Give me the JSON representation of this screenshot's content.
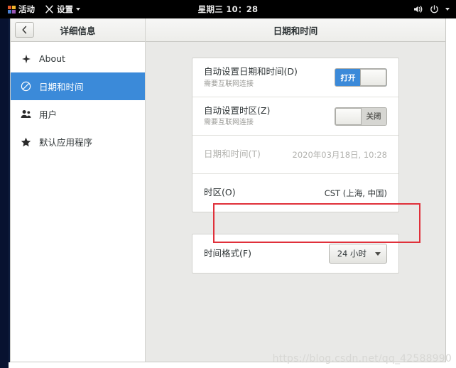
{
  "topbar": {
    "activities_label": "活动",
    "activities_icon": "activities-grid-icon",
    "app_menu_label": "设置",
    "app_menu_icon": "tools-icon",
    "app_menu_caret": "chevron-down-icon",
    "clock": "星期三 10：28",
    "volume_icon": "volume-speaker-icon",
    "power_icon": "power-icon",
    "system_caret": "chevron-down-icon"
  },
  "sidebar": {
    "back_icon": "chevron-left-icon",
    "title": "详细信息",
    "items": [
      {
        "label": "About",
        "icon": "sparkle-icon",
        "selected": false
      },
      {
        "label": "日期和时间",
        "icon": "clock-icon",
        "selected": true
      },
      {
        "label": "用户",
        "icon": "users-icon",
        "selected": false
      },
      {
        "label": "默认应用程序",
        "icon": "star-icon",
        "selected": false
      }
    ]
  },
  "main": {
    "title": "日期和时间",
    "cards": [
      {
        "rows": [
          {
            "title": "自动设置日期和时间(D)",
            "subtitle": "需要互联网连接",
            "control": "switch",
            "switch_state": "on",
            "switch_label": "打开",
            "disabled": false
          },
          {
            "title": "自动设置时区(Z)",
            "subtitle": "需要互联网连接",
            "control": "switch",
            "switch_state": "off",
            "switch_label": "关闭",
            "disabled": false
          },
          {
            "title": "日期和时间(T)",
            "subtitle": "",
            "control": "value",
            "value": "2020年03月18日, 10:28",
            "disabled": true
          },
          {
            "title": "时区(O)",
            "subtitle": "",
            "control": "value",
            "value": "CST (上海, 中国)",
            "disabled": false,
            "highlighted": true
          }
        ]
      },
      {
        "rows": [
          {
            "title": "时间格式(F)",
            "subtitle": "",
            "control": "combo",
            "value": "24 小时",
            "caret_icon": "chevron-down-icon",
            "disabled": false
          }
        ]
      }
    ]
  },
  "annotation": {
    "highlight_color": "#e0303a",
    "target": "时区(O)"
  },
  "watermark": {
    "text": "https://blog.csdn.net/qq_42588990"
  }
}
